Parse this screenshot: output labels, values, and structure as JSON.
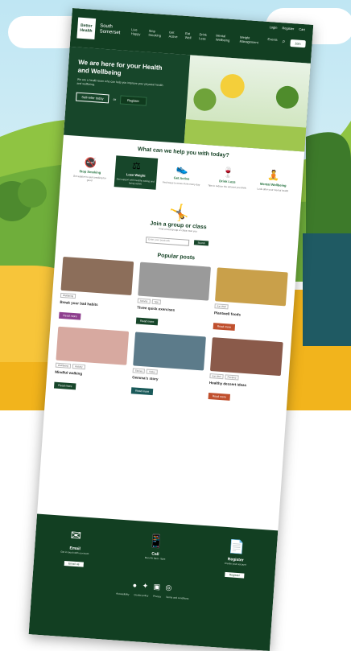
{
  "site": {
    "logo_text": "Better Health",
    "brand_name": "South Somerset",
    "top_links": [
      "Login",
      "Register",
      "Cart"
    ],
    "nav_links": [
      "Live Happy",
      "Stop Smoking",
      "Get Active",
      "Eat Well",
      "Drink Less",
      "Mental Wellbeing",
      "Weight Management",
      "Events"
    ],
    "nav_button": "Join"
  },
  "hero": {
    "title": "We are here for your Health and Wellbeing",
    "subtitle": "We are a health team who can help you improve your physical health and wellbeing.",
    "primary_button": "Self-refer today",
    "or_label": "or",
    "secondary_button": "Register"
  },
  "help": {
    "title": "What can we help you with today?",
    "items": [
      {
        "label": "Stop Smoking",
        "desc": "Get support to quit smoking for good",
        "icon": "🚭"
      },
      {
        "label": "Lose Weight",
        "desc": "Get support with healthy eating and being active",
        "icon": "⚖"
      },
      {
        "label": "Get Active",
        "desc": "Find ways to move more every day",
        "icon": "👟"
      },
      {
        "label": "Drink Less",
        "desc": "Tips to reduce the amount you drink",
        "icon": "🍷"
      },
      {
        "label": "Mental Wellbeing",
        "desc": "Look after your mental health",
        "icon": "🧘"
      }
    ]
  },
  "group": {
    "title": "Join a group or class",
    "subtitle": "Find a local group or class near you",
    "input_placeholder": "Enter your postcode",
    "button": "Search"
  },
  "posts": {
    "title": "Popular posts",
    "items": [
      {
        "title": "Break your bad habits",
        "date": "",
        "tags": [
          "Wellbeing"
        ],
        "desc": "",
        "button": "Read more",
        "btn_color": "#8e3f8e",
        "img_color": "#8c6e5a"
      },
      {
        "title": "Three quick exercises",
        "date": "",
        "tags": [
          "Activity",
          "Tips"
        ],
        "desc": "",
        "button": "Read more",
        "btn_color": "#17462a",
        "img_color": "#9a9a9a"
      },
      {
        "title": "Plantwell foods",
        "date": "",
        "tags": [
          "Eat Well"
        ],
        "desc": "",
        "button": "Read more",
        "btn_color": "#c0502e",
        "img_color": "#c9a04a"
      },
      {
        "title": "Mindful walking",
        "date": "",
        "tags": [
          "Wellbeing",
          "Activity"
        ],
        "desc": "",
        "button": "Read more",
        "btn_color": "#17462a",
        "img_color": "#d7a9a0"
      },
      {
        "title": "Gemma's story",
        "date": "",
        "tags": [
          "Stories",
          "Video"
        ],
        "desc": "",
        "button": "Read more",
        "btn_color": "#1a5a5a",
        "img_color": "#5c7b8a"
      },
      {
        "title": "Healthy dessert ideas",
        "date": "",
        "tags": [
          "Eat Well",
          "Recipes"
        ],
        "desc": "",
        "button": "Read more",
        "btn_color": "#c0502e",
        "img_color": "#8a5a4a"
      }
    ]
  },
  "footer": {
    "columns": [
      {
        "icon": "✉",
        "title": "Email",
        "sub": "Get in touch with our team",
        "button": "Email us"
      },
      {
        "icon": "📱",
        "title": "Call",
        "sub": "Mon-Fri 9am - 5pm",
        "button": ""
      },
      {
        "icon": "📄",
        "title": "Register",
        "sub": "Create your account",
        "button": "Register"
      }
    ],
    "social": "● ✦ ▣ ◎",
    "links": [
      "Accessibility",
      "Cookie policy",
      "Privacy",
      "Terms and conditions"
    ]
  },
  "colors": {
    "primary": "#123f22",
    "accent": "#1f6e3a",
    "background_yellow": "#f2b41c"
  }
}
